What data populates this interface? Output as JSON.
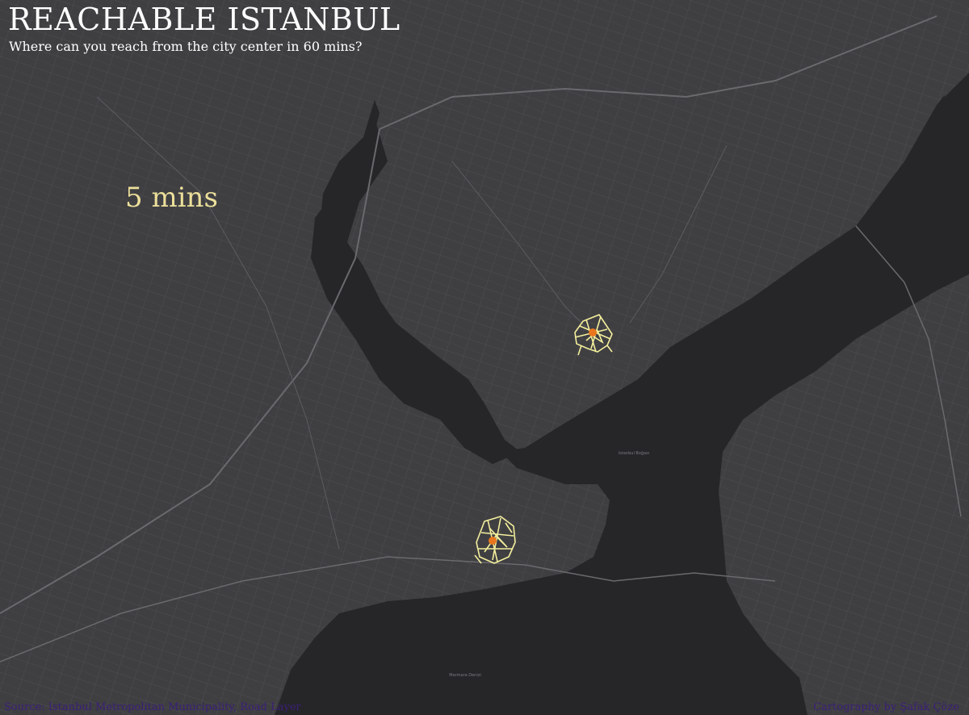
{
  "title": "REACHABLE ISTANBUL",
  "subtitle": "Where can you reach from the city center in 60 mins?",
  "time_label": "5 mins",
  "source": "Source: Istanbul Metropolitan Municipality, Road Layer",
  "credit": "Cartography by Şafak Çöze",
  "map": {
    "land_color": "#3f3f42",
    "water_color": "#262629",
    "road_color": "#5a5a5e",
    "reach_color": "#f4ef9c",
    "center_color": "#e8761e"
  },
  "places": [
    {
      "name": "Istanbul Boğazı"
    },
    {
      "name": "Marmara Denizi"
    }
  ],
  "centers": [
    {
      "name": "center-north"
    },
    {
      "name": "center-south"
    }
  ]
}
